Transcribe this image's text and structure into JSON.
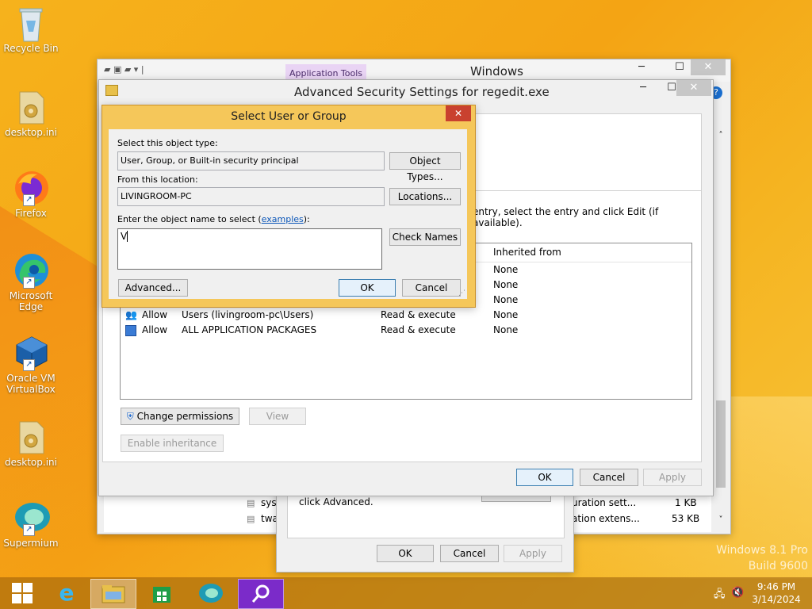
{
  "desktop": {
    "icons": [
      {
        "label": "Recycle Bin"
      },
      {
        "label": "desktop.ini"
      },
      {
        "label": "Firefox"
      },
      {
        "label": "Microsoft Edge"
      },
      {
        "label": "Oracle VM VirtualBox"
      },
      {
        "label": "desktop.ini"
      },
      {
        "label": "Supermium"
      }
    ],
    "watermark": {
      "line1": "Windows 8.1 Pro",
      "line2": "Build 9600"
    }
  },
  "explorer": {
    "ribbon_tab": "Application Tools",
    "title": "Windows",
    "files": [
      {
        "name": "syst",
        "type": "uration sett...",
        "size": "1 KB"
      },
      {
        "name": "twa",
        "type": "ation extens...",
        "size": "53 KB"
      }
    ]
  },
  "advanced_security": {
    "title": "Advanced Security Settings for regedit.exe",
    "instruction": "entry, select the entry and click Edit (if available).",
    "columns": {
      "inherited": "Inherited from"
    },
    "entries": [
      {
        "type": "",
        "principal": "",
        "access": "",
        "inherited": "None"
      },
      {
        "type": "",
        "principal": "",
        "access": "",
        "inherited": "None"
      },
      {
        "type": "",
        "principal": "",
        "access": "",
        "inherited": "None"
      },
      {
        "type": "Allow",
        "principal": "Users (livingroom-pc\\Users)",
        "access": "Read & execute",
        "inherited": "None"
      },
      {
        "type": "Allow",
        "principal": "ALL APPLICATION PACKAGES",
        "access": "Read & execute",
        "inherited": "None"
      }
    ],
    "change_permissions": "Change permissions",
    "view": "View",
    "enable_inheritance": "Enable inheritance",
    "ok": "OK",
    "cancel": "Cancel",
    "apply": "Apply"
  },
  "properties": {
    "hint": "click Advanced.",
    "ok": "OK",
    "cancel": "Cancel",
    "apply": "Apply"
  },
  "select_dialog": {
    "title": "Select User or Group",
    "object_type_label": "Select this object type:",
    "object_type_value": "User, Group, or Built-in security principal",
    "object_types_button": "Object Types...",
    "location_label": "From this location:",
    "location_value": "LIVINGROOM-PC",
    "locations_button": "Locations...",
    "name_label": "Enter the object name to select (",
    "examples_link": "examples",
    "name_label_end": "):",
    "name_value": "V",
    "check_names_button": "Check Names",
    "advanced_button": "Advanced...",
    "ok": "OK",
    "cancel": "Cancel"
  },
  "taskbar": {
    "time": "9:46 PM",
    "date": "3/14/2024"
  }
}
